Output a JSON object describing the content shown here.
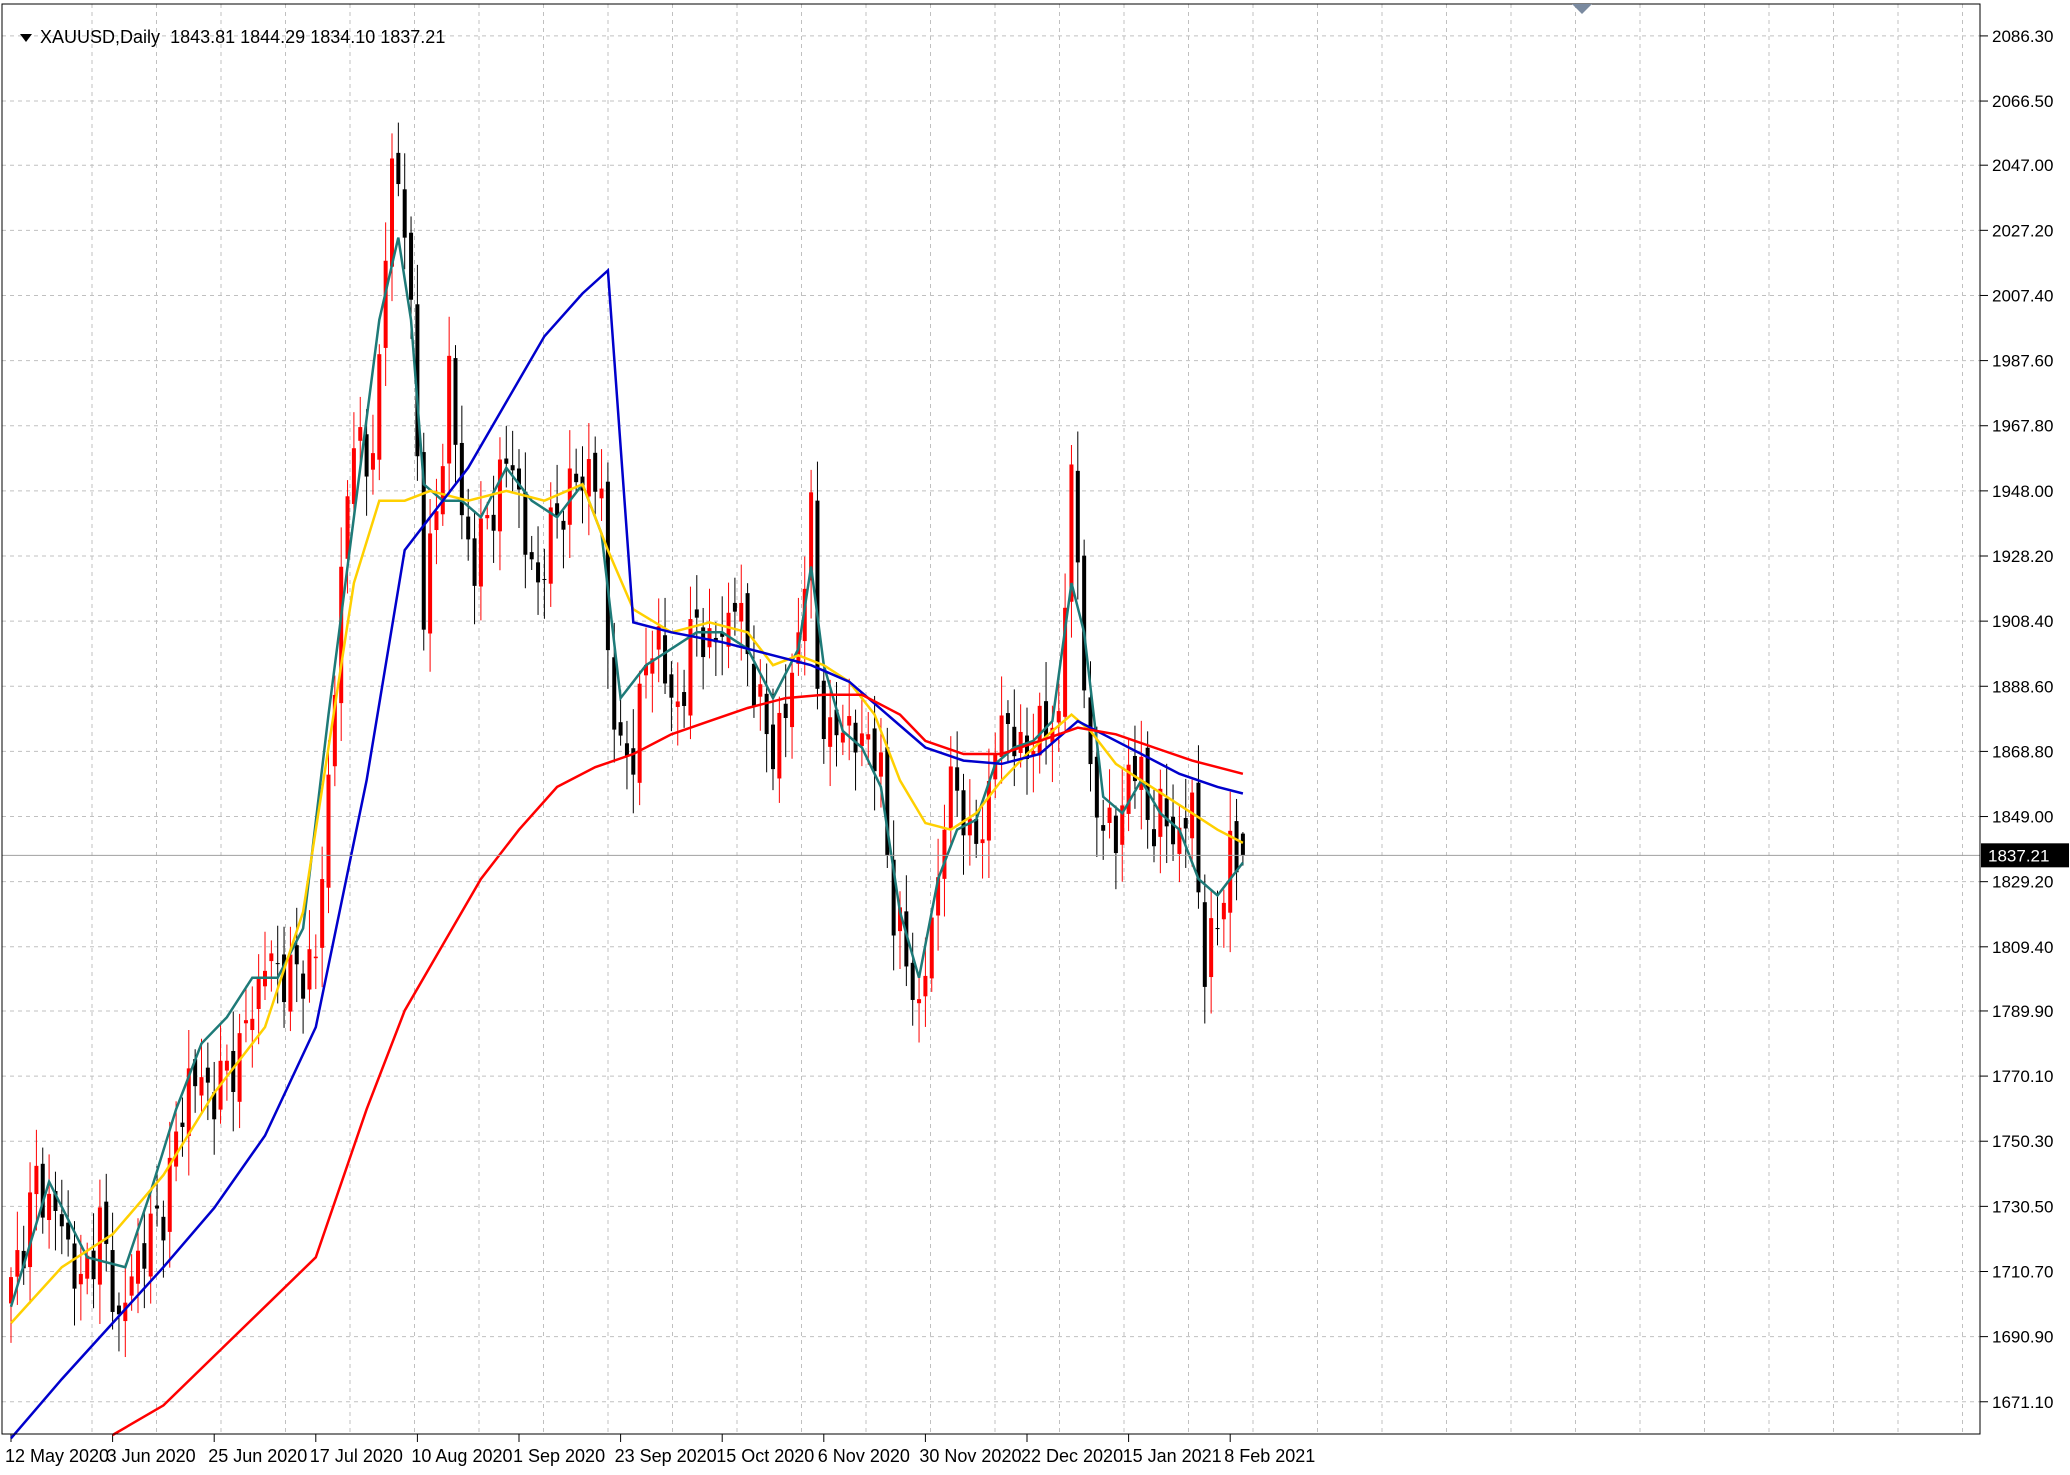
{
  "header": {
    "symbol_timeframe": "XAUUSD,Daily",
    "ohlc": "1843.81 1844.29 1834.10 1837.21"
  },
  "colors": {
    "bull": "#ff0000",
    "bear": "#000000",
    "ma_fast": "#1e7a78",
    "ma_yellow": "#ffd000",
    "ma_blue": "#0000cc",
    "ma_red": "#ff0000",
    "grid": "#c0c0c0",
    "price_tag_bg": "#000000",
    "price_tag_text": "#ffffff"
  },
  "chart_data": {
    "type": "candlestick",
    "ylim": [
      1661.3,
      2096.0
    ],
    "y_ticks": [
      "2086.30",
      "2066.50",
      "2047.00",
      "2027.20",
      "2007.40",
      "1987.60",
      "1967.80",
      "1948.00",
      "1928.20",
      "1908.40",
      "1888.60",
      "1868.80",
      "1849.00",
      "1829.20",
      "1809.40",
      "1789.90",
      "1770.10",
      "1750.30",
      "1730.50",
      "1710.70",
      "1690.90",
      "1671.10"
    ],
    "x_labels": [
      "12 May 2020",
      "3 Jun 2020",
      "25 Jun 2020",
      "17 Jul 2020",
      "10 Aug 2020",
      "1 Sep 2020",
      "23 Sep 2020",
      "15 Oct 2020",
      "6 Nov 2020",
      "30 Nov 2020",
      "22 Dec 2020",
      "15 Jan 2021",
      "8 Feb 2021"
    ],
    "x_label_bar_index": [
      0,
      16,
      32,
      48,
      64,
      80,
      96,
      112,
      128,
      144,
      160,
      176,
      192
    ],
    "current_price": "1837.21",
    "current_price_value": 1837.21,
    "close_path": [
      [
        0,
        1705
      ],
      [
        4,
        1738
      ],
      [
        8,
        1725
      ],
      [
        11,
        1705
      ],
      [
        14,
        1725
      ],
      [
        17,
        1695
      ],
      [
        20,
        1715
      ],
      [
        24,
        1730
      ],
      [
        28,
        1770
      ],
      [
        32,
        1765
      ],
      [
        36,
        1778
      ],
      [
        40,
        1805
      ],
      [
        44,
        1800
      ],
      [
        48,
        1805
      ],
      [
        50,
        1860
      ],
      [
        52,
        1920
      ],
      [
        54,
        1970
      ],
      [
        56,
        1950
      ],
      [
        58,
        1985
      ],
      [
        60,
        2050
      ],
      [
        62,
        2030
      ],
      [
        63,
        2000
      ],
      [
        65,
        1915
      ],
      [
        67,
        1940
      ],
      [
        69,
        1985
      ],
      [
        71,
        1940
      ],
      [
        73,
        1925
      ],
      [
        75,
        1940
      ],
      [
        77,
        1950
      ],
      [
        79,
        1960
      ],
      [
        81,
        1930
      ],
      [
        83,
        1920
      ],
      [
        85,
        1935
      ],
      [
        87,
        1945
      ],
      [
        89,
        1950
      ],
      [
        91,
        1955
      ],
      [
        93,
        1945
      ],
      [
        94,
        1900
      ],
      [
        96,
        1865
      ],
      [
        98,
        1870
      ],
      [
        100,
        1895
      ],
      [
        102,
        1905
      ],
      [
        104,
        1880
      ],
      [
        106,
        1890
      ],
      [
        108,
        1910
      ],
      [
        110,
        1900
      ],
      [
        112,
        1905
      ],
      [
        114,
        1915
      ],
      [
        116,
        1900
      ],
      [
        118,
        1880
      ],
      [
        120,
        1870
      ],
      [
        122,
        1880
      ],
      [
        124,
        1905
      ],
      [
        126,
        1940
      ],
      [
        127,
        1890
      ],
      [
        129,
        1870
      ],
      [
        131,
        1880
      ],
      [
        133,
        1870
      ],
      [
        135,
        1875
      ],
      [
        137,
        1860
      ],
      [
        139,
        1820
      ],
      [
        141,
        1805
      ],
      [
        143,
        1790
      ],
      [
        145,
        1815
      ],
      [
        147,
        1850
      ],
      [
        149,
        1860
      ],
      [
        151,
        1840
      ],
      [
        153,
        1845
      ],
      [
        155,
        1870
      ],
      [
        157,
        1880
      ],
      [
        159,
        1865
      ],
      [
        161,
        1875
      ],
      [
        163,
        1875
      ],
      [
        165,
        1880
      ],
      [
        167,
        1950
      ],
      [
        168,
        1930
      ],
      [
        170,
        1855
      ],
      [
        172,
        1850
      ],
      [
        174,
        1840
      ],
      [
        176,
        1865
      ],
      [
        178,
        1860
      ],
      [
        180,
        1845
      ],
      [
        182,
        1850
      ],
      [
        184,
        1840
      ],
      [
        186,
        1855
      ],
      [
        188,
        1800
      ],
      [
        190,
        1820
      ],
      [
        192,
        1835
      ],
      [
        194,
        1837.21
      ]
    ],
    "series": [
      {
        "name": "",
        "color": "#1e7a78",
        "values": [
          [
            0,
            1700
          ],
          [
            6,
            1738
          ],
          [
            12,
            1715
          ],
          [
            18,
            1712
          ],
          [
            22,
            1735
          ],
          [
            26,
            1760
          ],
          [
            30,
            1780
          ],
          [
            34,
            1788
          ],
          [
            38,
            1800
          ],
          [
            42,
            1800
          ],
          [
            46,
            1815
          ],
          [
            50,
            1880
          ],
          [
            54,
            1940
          ],
          [
            58,
            2000
          ],
          [
            61,
            2025
          ],
          [
            63,
            2000
          ],
          [
            65,
            1950
          ],
          [
            68,
            1945
          ],
          [
            71,
            1945
          ],
          [
            74,
            1940
          ],
          [
            78,
            1955
          ],
          [
            82,
            1945
          ],
          [
            86,
            1940
          ],
          [
            90,
            1950
          ],
          [
            93,
            1935
          ],
          [
            96,
            1885
          ],
          [
            100,
            1895
          ],
          [
            104,
            1900
          ],
          [
            108,
            1905
          ],
          [
            112,
            1905
          ],
          [
            116,
            1900
          ],
          [
            120,
            1885
          ],
          [
            124,
            1900
          ],
          [
            126,
            1925
          ],
          [
            128,
            1895
          ],
          [
            131,
            1875
          ],
          [
            134,
            1870
          ],
          [
            137,
            1858
          ],
          [
            140,
            1820
          ],
          [
            143,
            1800
          ],
          [
            146,
            1830
          ],
          [
            149,
            1845
          ],
          [
            152,
            1848
          ],
          [
            155,
            1865
          ],
          [
            158,
            1870
          ],
          [
            161,
            1872
          ],
          [
            164,
            1878
          ],
          [
            167,
            1920
          ],
          [
            169,
            1905
          ],
          [
            172,
            1855
          ],
          [
            175,
            1850
          ],
          [
            178,
            1860
          ],
          [
            181,
            1850
          ],
          [
            184,
            1845
          ],
          [
            187,
            1830
          ],
          [
            190,
            1825
          ],
          [
            194,
            1835
          ]
        ]
      },
      {
        "name": "",
        "color": "#ffd000",
        "values": [
          [
            0,
            1695
          ],
          [
            8,
            1712
          ],
          [
            16,
            1722
          ],
          [
            24,
            1740
          ],
          [
            32,
            1765
          ],
          [
            40,
            1785
          ],
          [
            46,
            1820
          ],
          [
            50,
            1870
          ],
          [
            54,
            1920
          ],
          [
            58,
            1945
          ],
          [
            62,
            1945
          ],
          [
            66,
            1948
          ],
          [
            72,
            1945
          ],
          [
            78,
            1948
          ],
          [
            84,
            1945
          ],
          [
            90,
            1950
          ],
          [
            94,
            1930
          ],
          [
            98,
            1912
          ],
          [
            104,
            1905
          ],
          [
            110,
            1908
          ],
          [
            116,
            1905
          ],
          [
            120,
            1895
          ],
          [
            124,
            1898
          ],
          [
            128,
            1895
          ],
          [
            132,
            1890
          ],
          [
            136,
            1880
          ],
          [
            140,
            1860
          ],
          [
            144,
            1847
          ],
          [
            148,
            1845
          ],
          [
            152,
            1850
          ],
          [
            156,
            1860
          ],
          [
            160,
            1868
          ],
          [
            164,
            1875
          ],
          [
            167,
            1880
          ],
          [
            170,
            1875
          ],
          [
            174,
            1865
          ],
          [
            178,
            1860
          ],
          [
            182,
            1855
          ],
          [
            186,
            1850
          ],
          [
            190,
            1845
          ],
          [
            194,
            1841
          ]
        ]
      },
      {
        "name": "",
        "color": "#0000cc",
        "values": [
          [
            0,
            1660
          ],
          [
            8,
            1678
          ],
          [
            16,
            1695
          ],
          [
            24,
            1712
          ],
          [
            32,
            1730
          ],
          [
            40,
            1752
          ],
          [
            48,
            1785
          ],
          [
            56,
            1860
          ],
          [
            62,
            1930
          ],
          [
            66,
            1940
          ],
          [
            72,
            1955
          ],
          [
            78,
            1975
          ],
          [
            84,
            1995
          ],
          [
            90,
            2008
          ],
          [
            94,
            2015
          ],
          [
            98,
            1908
          ],
          [
            104,
            1905
          ],
          [
            112,
            1902
          ],
          [
            120,
            1898
          ],
          [
            126,
            1895
          ],
          [
            132,
            1890
          ],
          [
            138,
            1880
          ],
          [
            144,
            1870
          ],
          [
            150,
            1866
          ],
          [
            156,
            1865
          ],
          [
            162,
            1868
          ],
          [
            168,
            1878
          ],
          [
            172,
            1874
          ],
          [
            178,
            1868
          ],
          [
            184,
            1862
          ],
          [
            190,
            1858
          ],
          [
            194,
            1856
          ]
        ]
      },
      {
        "name": "",
        "color": "#ff0000",
        "values": [
          [
            16,
            1661
          ],
          [
            24,
            1670
          ],
          [
            32,
            1685
          ],
          [
            40,
            1700
          ],
          [
            48,
            1715
          ],
          [
            56,
            1760
          ],
          [
            62,
            1790
          ],
          [
            68,
            1810
          ],
          [
            74,
            1830
          ],
          [
            80,
            1845
          ],
          [
            86,
            1858
          ],
          [
            92,
            1864
          ],
          [
            98,
            1868
          ],
          [
            104,
            1874
          ],
          [
            110,
            1878
          ],
          [
            116,
            1882
          ],
          [
            122,
            1885
          ],
          [
            128,
            1886
          ],
          [
            134,
            1886
          ],
          [
            140,
            1880
          ],
          [
            144,
            1872
          ],
          [
            150,
            1868
          ],
          [
            156,
            1868
          ],
          [
            162,
            1872
          ],
          [
            168,
            1876
          ],
          [
            174,
            1874
          ],
          [
            180,
            1870
          ],
          [
            186,
            1866
          ],
          [
            190,
            1864
          ],
          [
            194,
            1862
          ]
        ]
      }
    ]
  }
}
